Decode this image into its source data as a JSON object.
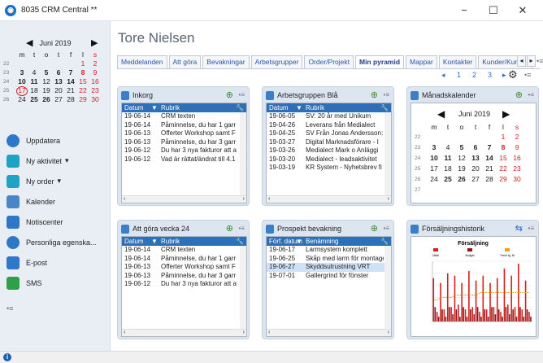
{
  "window": {
    "title": "8035 CRM Central **",
    "minimize": "−",
    "maximize": "☐",
    "close": "✕"
  },
  "mini_calendar": {
    "month": "Juni 2019",
    "weekdays": [
      "m",
      "t",
      "o",
      "t",
      "f",
      "l",
      "s"
    ],
    "weeks": [
      {
        "wk": "22",
        "days": [
          "",
          "",
          "",
          "",
          "",
          "1",
          "2"
        ]
      },
      {
        "wk": "23",
        "days": [
          "3",
          "4",
          "5",
          "6",
          "7",
          "8",
          "9"
        ]
      },
      {
        "wk": "24",
        "days": [
          "10",
          "11",
          "12",
          "13",
          "14",
          "15",
          "16"
        ]
      },
      {
        "wk": "25",
        "days": [
          "17",
          "18",
          "19",
          "20",
          "21",
          "22",
          "23"
        ]
      },
      {
        "wk": "26",
        "days": [
          "24",
          "25",
          "26",
          "27",
          "28",
          "29",
          "30"
        ]
      }
    ]
  },
  "menu": [
    {
      "label": "Uppdatera",
      "icon": "refresh-icon"
    },
    {
      "label": "Ny aktivitet",
      "icon": "new-activity-icon",
      "dropdown": "▾"
    },
    {
      "label": "Ny order",
      "icon": "new-order-icon",
      "dropdown": "▾"
    },
    {
      "label": "Kalender",
      "icon": "calendar-icon"
    },
    {
      "label": "Notiscenter",
      "icon": "notification-center-icon"
    },
    {
      "label": "Personliga egenska...",
      "icon": "personal-settings-icon"
    },
    {
      "label": "E-post",
      "icon": "email-icon"
    },
    {
      "label": "SMS",
      "icon": "sms-icon"
    }
  ],
  "menu_more": "•≡",
  "person_name": "Tore Nielsen",
  "tabs": [
    "Meddelanden",
    "Att göra",
    "Bevakningar",
    "Arbetsgrupper",
    "Order/Projekt",
    "Min pyramid",
    "Mappar",
    "Kontakter",
    "Kunder/Kund..."
  ],
  "active_tab": "Min pyramid",
  "tab_nav": {
    "prev": "◂",
    "next": "▸",
    "extra": "•≡"
  },
  "pager": {
    "prev": "◂",
    "pages": [
      "1",
      "2",
      "3"
    ],
    "next": "▸"
  },
  "widget_menu": "•≡",
  "inkorg": {
    "title": "Inkorg",
    "columns": [
      "Datum",
      "Rubrik"
    ],
    "rows": [
      [
        "19-06-14",
        "CRM texten"
      ],
      [
        "19-06-14",
        "Påminnelse, du har 1 garr"
      ],
      [
        "19-06-13",
        "Offerter Workshop samt F"
      ],
      [
        "19-06-13",
        "Påminnelse, du har 3 garr"
      ],
      [
        "19-06-12",
        "Du har 3 nya fakturor att a"
      ],
      [
        "19-06-12",
        "Vad är rättat/ändrat till 4.1"
      ]
    ]
  },
  "arbetsgruppen": {
    "title": "Arbetsgruppen Blå",
    "columns": [
      "Datum",
      "Rubrik"
    ],
    "rows": [
      [
        "19-06-05",
        "SV: 20 år med Unikum"
      ],
      [
        "19-04-26",
        "Leverans från Medialect"
      ],
      [
        "19-04-25",
        "SV Från Jonas Andersson:"
      ],
      [
        "19-03-27",
        "Digital Marknadsförare - I"
      ],
      [
        "19-03-26",
        "Medialect Mark o Anläggi"
      ],
      [
        "19-03-20",
        "Medialect - leadsaktivitet"
      ],
      [
        "19-03-19",
        "KR System - Nyhetsbrev fi"
      ]
    ]
  },
  "manadskalender": {
    "title": "Månadskalender",
    "month": "Juni 2019",
    "weekdays": [
      "m",
      "t",
      "o",
      "t",
      "f",
      "l",
      "s"
    ],
    "weeks": [
      {
        "wk": "22",
        "days": [
          "",
          "",
          "",
          "",
          "",
          "1",
          "2"
        ]
      },
      {
        "wk": "23",
        "days": [
          "3",
          "4",
          "5",
          "6",
          "7",
          "8",
          "9"
        ]
      },
      {
        "wk": "24",
        "days": [
          "10",
          "11",
          "12",
          "13",
          "14",
          "15",
          "16"
        ]
      },
      {
        "wk": "25",
        "days": [
          "17",
          "18",
          "19",
          "20",
          "21",
          "22",
          "23"
        ]
      },
      {
        "wk": "26",
        "days": [
          "24",
          "25",
          "26",
          "27",
          "28",
          "29",
          "30"
        ]
      },
      {
        "wk": "27",
        "days": [
          "",
          "",
          "",
          "",
          "",
          "",
          ""
        ]
      }
    ]
  },
  "att_gora": {
    "title": "Att göra vecka 24",
    "columns": [
      "Datum",
      "Rubrik"
    ],
    "rows": [
      [
        "19-06-14",
        "CRM texten"
      ],
      [
        "19-06-14",
        "Påminnelse, du har 1 garr"
      ],
      [
        "19-06-13",
        "Offerter Workshop samt F"
      ],
      [
        "19-06-13",
        "Påminnelse, du har 3 garr"
      ],
      [
        "19-06-12",
        "Du har 3 nya fakturor att a"
      ]
    ]
  },
  "prospekt": {
    "title": "Prospekt bevakning",
    "columns": [
      "Förf. datum",
      "Benämning"
    ],
    "rows": [
      [
        "19-06-17",
        "Larmsystem komplett"
      ],
      [
        "19-06-25",
        "Skåp med larm för montage ."
      ],
      [
        "19-06-27",
        "Skyddsutrustning VRT"
      ],
      [
        "19-07-01",
        "Gallergrind för fönster"
      ]
    ],
    "selected_row": 2
  },
  "forsaljning": {
    "title": "Försäljningshistorik",
    "settings_icon": "⇆"
  },
  "chart_data": {
    "type": "bar",
    "title": "Försäljning",
    "series": [
      {
        "name": "Utfall",
        "color": "#d42020",
        "values": [
          18,
          4,
          16,
          5,
          20,
          6,
          19,
          7,
          16,
          5,
          21,
          6,
          17,
          4,
          19,
          5,
          16,
          6,
          18,
          4,
          22,
          7,
          19,
          6,
          24,
          5,
          17,
          4
        ]
      },
      {
        "name": "Budget",
        "color": "#8a1a1a",
        "values": [
          6,
          2,
          5,
          2,
          6,
          3,
          5,
          2,
          6,
          2,
          5,
          3,
          6,
          2,
          5,
          2,
          6,
          3,
          5,
          2,
          6,
          3,
          5,
          2,
          6,
          2,
          5,
          2
        ]
      },
      {
        "name": "Trend fg. år",
        "color": "#f0a020",
        "values": [
          9,
          9,
          10,
          10,
          10,
          10,
          11,
          11,
          11,
          11,
          11,
          11,
          11,
          12,
          12,
          12,
          12,
          12,
          12,
          12,
          12,
          12,
          12,
          12,
          12,
          12,
          12,
          12
        ]
      }
    ],
    "ylim": [
      0,
      25
    ]
  },
  "colors": {
    "accent": "#2e6fb8",
    "today": "#d42020"
  }
}
